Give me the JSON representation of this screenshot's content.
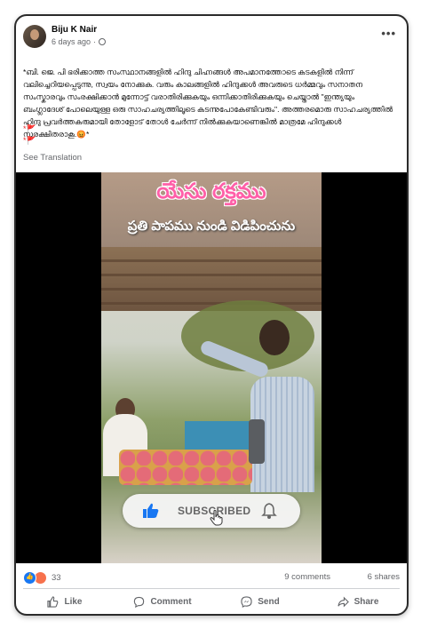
{
  "post": {
    "author": "Biju K Nair",
    "time": "6 days ago",
    "caption": "*ബി. ജെ. പി ഭരിക്കാത്ത സംസ്ഥാനങ്ങളിൽ ഹിന്ദു ചിഹ്നങ്ങൾ അപമാനത്തോടെ കടകളിൽ നിന്ന് വലിച്ചെറിയപ്പെടുന്നു, സ്വയം നോക്കുക. വരും കാലങ്ങളിൽ ഹിന്ദുക്കൾ അവരുടെ ധർമ്മവും സനാതന സംസ്കാരവും സംരക്ഷിക്കാൻ മുന്നോട്ട് വരാതിരിക്കുകയും ഒന്നിക്കാതിരിക്കുകയും ചെയ്താൽ \"ഇന്ത്യയും ബംഗ്ലാദേശ് പോലെയുള്ള ഒരു സാഹചര്യത്തിലൂടെ കടന്നുപോകേണ്ടിവരും\". അത്തരമൊരു സാഹചര്യത്തിൽ ഹിന്ദു പ്രവർത്തകരുമായി തോളോട് തോൾ ചേർന്ന് നിൽക്കുകയാണെങ്കിൽ മാത്രമേ ഹിന്ദുക്കൾ സുരക്ഷിതരാകൂ.😡*",
    "flag1": "*🚩",
    "flag2": "*🚩",
    "see_translation": "See Translation"
  },
  "video": {
    "title_line1": "యేసు రక్తము",
    "title_line2": "ప్రతి పాపము నుండి విడిపించును",
    "subscribe_label": "SUBSCRIBED"
  },
  "stats": {
    "reaction_count": "33",
    "comments": "9 comments",
    "shares": "6 shares"
  },
  "actions": {
    "like": "Like",
    "comment": "Comment",
    "send": "Send",
    "share": "Share"
  },
  "colors": {
    "accent": "#1877f2",
    "title_pink": "#ff5fa8",
    "secondary_text": "#65676b"
  }
}
